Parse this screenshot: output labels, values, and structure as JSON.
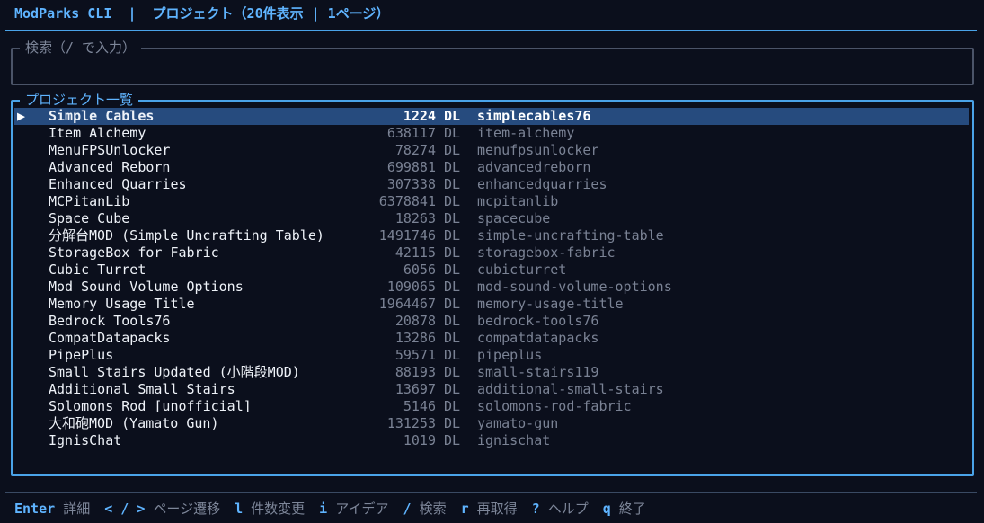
{
  "app": {
    "name": "ModParks CLI",
    "separator": "|",
    "screen_title": "プロジェクト（20件表示 | 1ページ）"
  },
  "search": {
    "label": "検索（/ で入力）",
    "value": ""
  },
  "list": {
    "label": "プロジェクト一覧",
    "selected_index": 0,
    "cursor_glyph": "▶",
    "dl_unit": "DL",
    "items": [
      {
        "name": "Simple Cables",
        "downloads": "1224",
        "slug": "simplecables76"
      },
      {
        "name": "Item Alchemy",
        "downloads": "638117",
        "slug": "item-alchemy"
      },
      {
        "name": "MenuFPSUnlocker",
        "downloads": "78274",
        "slug": "menufpsunlocker"
      },
      {
        "name": "Advanced Reborn",
        "downloads": "699881",
        "slug": "advancedreborn"
      },
      {
        "name": "Enhanced Quarries",
        "downloads": "307338",
        "slug": "enhancedquarries"
      },
      {
        "name": "MCPitanLib",
        "downloads": "6378841",
        "slug": "mcpitanlib"
      },
      {
        "name": "Space Cube",
        "downloads": "18263",
        "slug": "spacecube"
      },
      {
        "name": "分解台MOD (Simple Uncrafting Table)",
        "downloads": "1491746",
        "slug": "simple-uncrafting-table"
      },
      {
        "name": "StorageBox for Fabric",
        "downloads": "42115",
        "slug": "storagebox-fabric"
      },
      {
        "name": "Cubic Turret",
        "downloads": "6056",
        "slug": "cubicturret"
      },
      {
        "name": "Mod Sound Volume Options",
        "downloads": "109065",
        "slug": "mod-sound-volume-options"
      },
      {
        "name": "Memory Usage Title",
        "downloads": "1964467",
        "slug": "memory-usage-title"
      },
      {
        "name": "Bedrock Tools76",
        "downloads": "20878",
        "slug": "bedrock-tools76"
      },
      {
        "name": "CompatDatapacks",
        "downloads": "13286",
        "slug": "compatdatapacks"
      },
      {
        "name": "PipePlus",
        "downloads": "59571",
        "slug": "pipeplus"
      },
      {
        "name": "Small Stairs Updated (小階段MOD)",
        "downloads": "88193",
        "slug": "small-stairs119"
      },
      {
        "name": "Additional Small Stairs",
        "downloads": "13697",
        "slug": "additional-small-stairs"
      },
      {
        "name": "Solomons Rod [unofficial]",
        "downloads": "5146",
        "slug": "solomons-rod-fabric"
      },
      {
        "name": "大和砲MOD (Yamato Gun)",
        "downloads": "131253",
        "slug": "yamato-gun"
      },
      {
        "name": "IgnisChat",
        "downloads": "1019",
        "slug": "ignischat"
      }
    ]
  },
  "footer": {
    "keybinds": [
      {
        "key": "Enter",
        "desc": "詳細"
      },
      {
        "key": "< / >",
        "desc": "ページ遷移"
      },
      {
        "key": "l",
        "desc": "件数変更"
      },
      {
        "key": "i",
        "desc": "アイデア"
      },
      {
        "key": "/",
        "desc": "検索"
      },
      {
        "key": "r",
        "desc": "再取得"
      },
      {
        "key": "?",
        "desc": "ヘルプ"
      },
      {
        "key": "q",
        "desc": "終了"
      }
    ]
  },
  "colors": {
    "background": "#0b0f1c",
    "accent": "#5fb4ff",
    "selection": "#264b7e",
    "muted": "#7a8294"
  }
}
